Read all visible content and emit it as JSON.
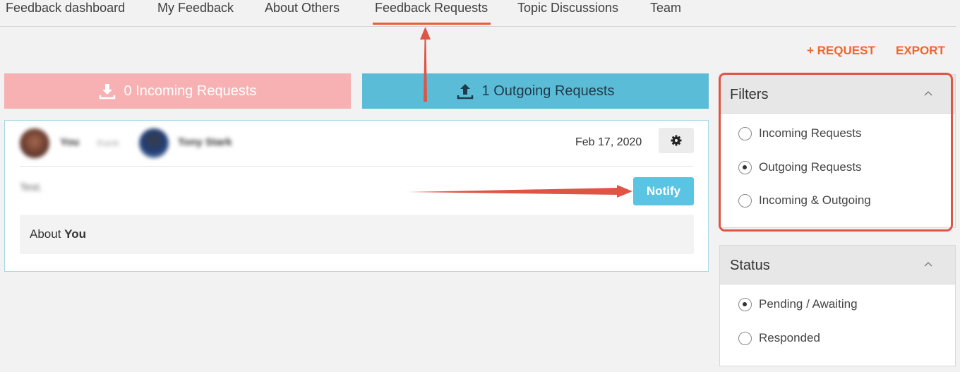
{
  "nav": {
    "items": [
      {
        "label": "Feedback dashboard"
      },
      {
        "label": "My Feedback"
      },
      {
        "label": "About Others"
      },
      {
        "label": "Feedback Requests",
        "active": true
      },
      {
        "label": "Topic Discussions"
      },
      {
        "label": "Team"
      }
    ]
  },
  "actions": {
    "request_label": "+ REQUEST",
    "export_label": "EXPORT"
  },
  "request_tabs": {
    "incoming_label": "0 Incoming Requests",
    "outgoing_label": "1 Outgoing Requests"
  },
  "card": {
    "from_name": "You",
    "verb": "thank",
    "to_name": "Tony Stark",
    "date": "Feb 17, 2020",
    "message": "Test.",
    "notify_label": "Notify",
    "about_prefix": "About",
    "about_target": "You"
  },
  "filters": {
    "title": "Filters",
    "options": [
      {
        "label": "Incoming Requests",
        "checked": false
      },
      {
        "label": "Outgoing Requests",
        "checked": true
      },
      {
        "label": "Incoming & Outgoing",
        "checked": false
      }
    ]
  },
  "status": {
    "title": "Status",
    "options": [
      {
        "label": "Pending / Awaiting",
        "checked": true
      },
      {
        "label": "Responded",
        "checked": false
      }
    ]
  },
  "colors": {
    "accent": "#f0642e",
    "incoming_tab": "#f7b1b3",
    "outgoing_tab": "#5bbcd7",
    "notify": "#5bc4e3",
    "annotation": "#df5444"
  },
  "icons": {
    "incoming": "download-icon",
    "outgoing": "upload-icon",
    "settings": "gear-icon",
    "collapse": "chevron-up-icon"
  }
}
